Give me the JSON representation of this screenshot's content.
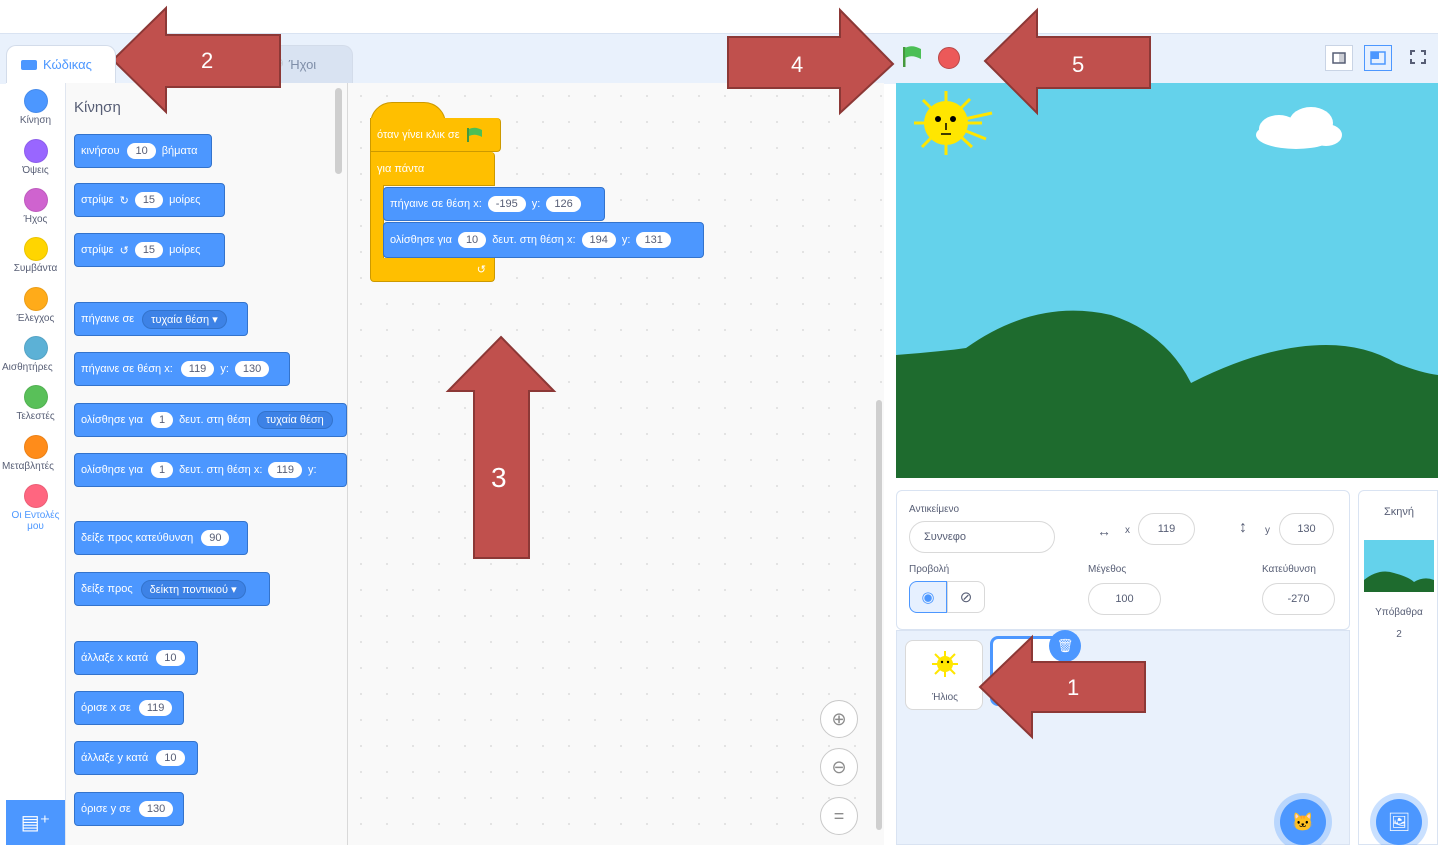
{
  "tabs": {
    "code": "Κώδικας",
    "sounds": "Ήχοι"
  },
  "categories": [
    {
      "label": "Κίνηση",
      "color": "#4c97ff"
    },
    {
      "label": "Όψεις",
      "color": "#9966ff"
    },
    {
      "label": "Ήχος",
      "color": "#cf63cf"
    },
    {
      "label": "Συμβάντα",
      "color": "#ffd500"
    },
    {
      "label": "Έλεγχος",
      "color": "#ffab19"
    },
    {
      "label": "Αισθητήρες",
      "color": "#5cb1d6"
    },
    {
      "label": "Τελεστές",
      "color": "#59c059"
    },
    {
      "label": "Μεταβλητές",
      "color": "#ff8c1a"
    },
    {
      "label": "Οι Εντολές μου",
      "color": "#ff6680"
    }
  ],
  "palette": {
    "title": "Κίνηση",
    "move": {
      "a": "κινήσου",
      "v": "10",
      "b": "βήματα"
    },
    "turn_right": {
      "a": "στρίψε",
      "v": "15",
      "b": "μοίρες"
    },
    "turn_left": {
      "a": "στρίψε",
      "v": "15",
      "b": "μοίρες"
    },
    "goto_random": {
      "a": "πήγαινε σε",
      "dd": "τυχαία θέση"
    },
    "goto_xy": {
      "a": "πήγαινε σε θέση x:",
      "x": "119",
      "yl": "y:",
      "y": "130"
    },
    "glide_random": {
      "a": "ολίσθησε για",
      "v": "1",
      "b": "δευτ. στη θέση",
      "dd": "τυχαία θέση"
    },
    "glide_xy": {
      "a": "ολίσθησε για",
      "v": "1",
      "b": "δευτ. στη θέση x:",
      "x": "119",
      "yl": "y:"
    },
    "point_dir": {
      "a": "δείξε προς κατεύθυνση",
      "v": "90"
    },
    "point_towards": {
      "a": "δείξε προς",
      "dd": "δείκτη ποντικιού"
    },
    "change_x": {
      "a": "άλλαξε x κατά",
      "v": "10"
    },
    "set_x": {
      "a": "όρισε x σε",
      "v": "119"
    },
    "change_y": {
      "a": "άλλαξε y κατά",
      "v": "10"
    },
    "set_y": {
      "a": "όρισε y σε",
      "v": "130"
    }
  },
  "script": {
    "hat": "όταν γίνει κλικ σε",
    "forever": "για πάντα",
    "goto": {
      "a": "πήγαινε σε θέση x:",
      "x": "-195",
      "yl": "y:",
      "y": "126"
    },
    "glide": {
      "a": "ολίσθησε για",
      "v": "10",
      "b": "δευτ. στη θέση x:",
      "x": "194",
      "yl": "y:",
      "y": "131"
    },
    "loop_arrow": "↺"
  },
  "zoom": {
    "in": "⊕",
    "out": "⊖",
    "reset": "="
  },
  "sprite_info": {
    "sprite_label": "Αντικείμενο",
    "sprite_name": "Συννεφο",
    "x_label": "x",
    "x_value": "119",
    "y_label": "y",
    "y_value": "130",
    "show_label": "Προβολή",
    "size_label": "Μέγεθος",
    "size_value": "100",
    "direction_label": "Κατεύθυνση",
    "direction_value": "-270"
  },
  "sprites": [
    {
      "name": "Ήλιος"
    }
  ],
  "stage_pane": {
    "title": "Σκηνή",
    "backdrops_label": "Υπόβαθρα",
    "backdrops_count": "2"
  },
  "arrows": [
    "1",
    "2",
    "3",
    "4",
    "5"
  ],
  "colors": {
    "arrow_fill": "#c0504d",
    "arrow_stroke": "#8c3836",
    "motion": "#4c97ff",
    "events": "#ffbf00",
    "sky": "#64d2eb",
    "hills": "#1e6b2e"
  }
}
